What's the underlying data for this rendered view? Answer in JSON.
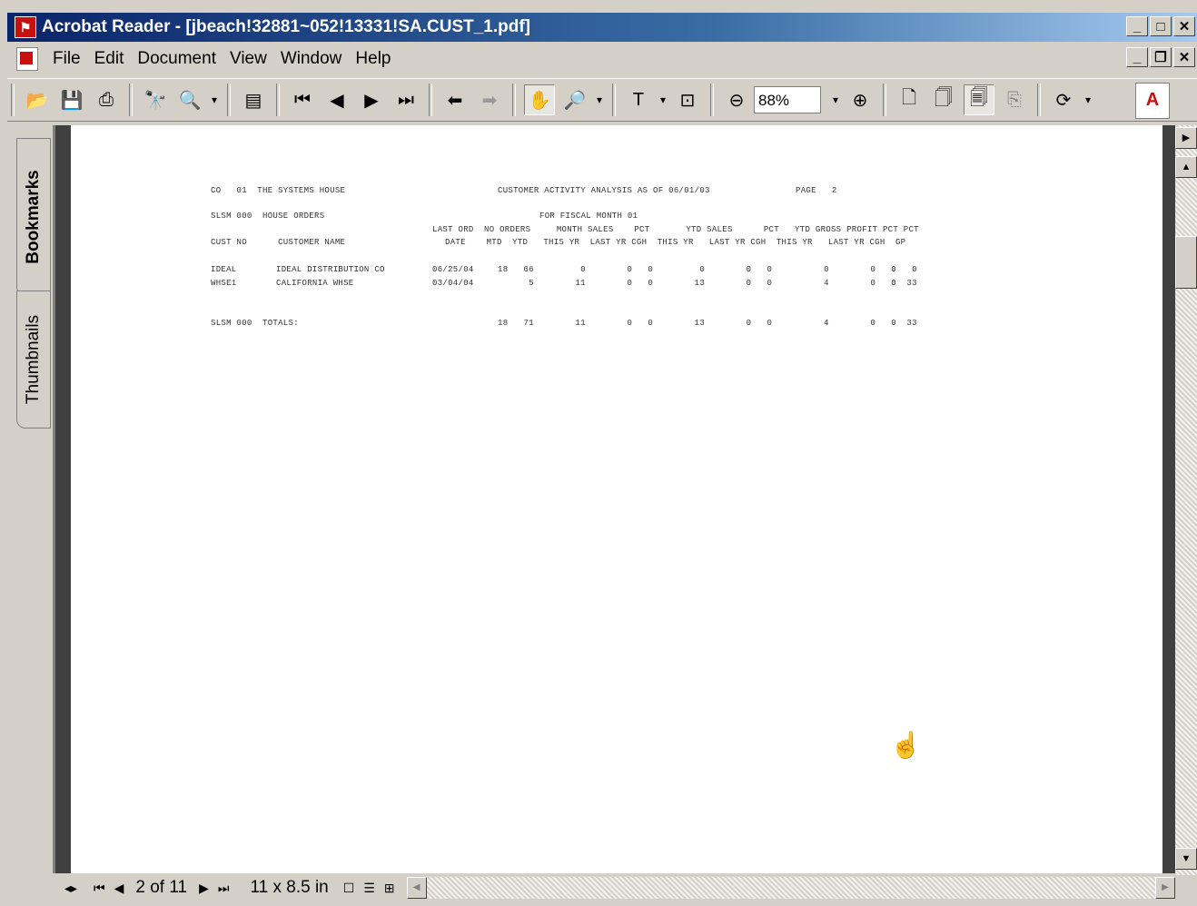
{
  "window": {
    "title": "Acrobat Reader - [jbeach!32881~052!13331!SA.CUST_1.pdf]",
    "min_glyph": "_",
    "max_glyph": "□",
    "restore_glyph": "❐",
    "close_glyph": "✕"
  },
  "menu": {
    "items": [
      "File",
      "Edit",
      "Document",
      "View",
      "Window",
      "Help"
    ]
  },
  "toolbar": {
    "zoom_value": "88%"
  },
  "nav_tabs": {
    "bookmarks": "Bookmarks",
    "thumbnails": "Thumbnails"
  },
  "report": {
    "header_co": "CO   01  THE SYSTEMS HOUSE",
    "header_title": "CUSTOMER ACTIVITY ANALYSIS AS OF 06/01/03",
    "header_page": "PAGE   2",
    "slsm_line": "SLSM 000  HOUSE ORDERS",
    "fiscal": "FOR FISCAL MONTH 01",
    "col_hdr1": "LAST ORD  NO ORDERS     MONTH SALES    PCT       YTD SALES      PCT   YTD GROSS PROFIT PCT PCT",
    "col_hdr2": "CUST NO      CUSTOMER NAME",
    "col_hdr3": "DATE    MTD  YTD   THIS YR  LAST YR CGH  THIS YR   LAST YR CGH  THIS YR   LAST YR CGH  GP",
    "rows": [
      {
        "cust": "IDEAL",
        "name": "IDEAL DISTRIBUTION CO",
        "date": "06/25/04",
        "figs": "18   66         0        0   0         0        0   0          0        0   0   0"
      },
      {
        "cust": "WHSE1",
        "name": "CALIFORNIA WHSE",
        "date": "03/04/04",
        "figs": "      5        11        0   0        13        0   0          4        0   0  33"
      }
    ],
    "totals_label": "SLSM 000  TOTALS:",
    "totals_figs": "18   71        11        0   0        13        0   0          4        0   0  33"
  },
  "status": {
    "page_indicator": "2 of 11",
    "page_size": "11 x 8.5 in"
  },
  "icons": {
    "hand_cursor": "☝"
  }
}
